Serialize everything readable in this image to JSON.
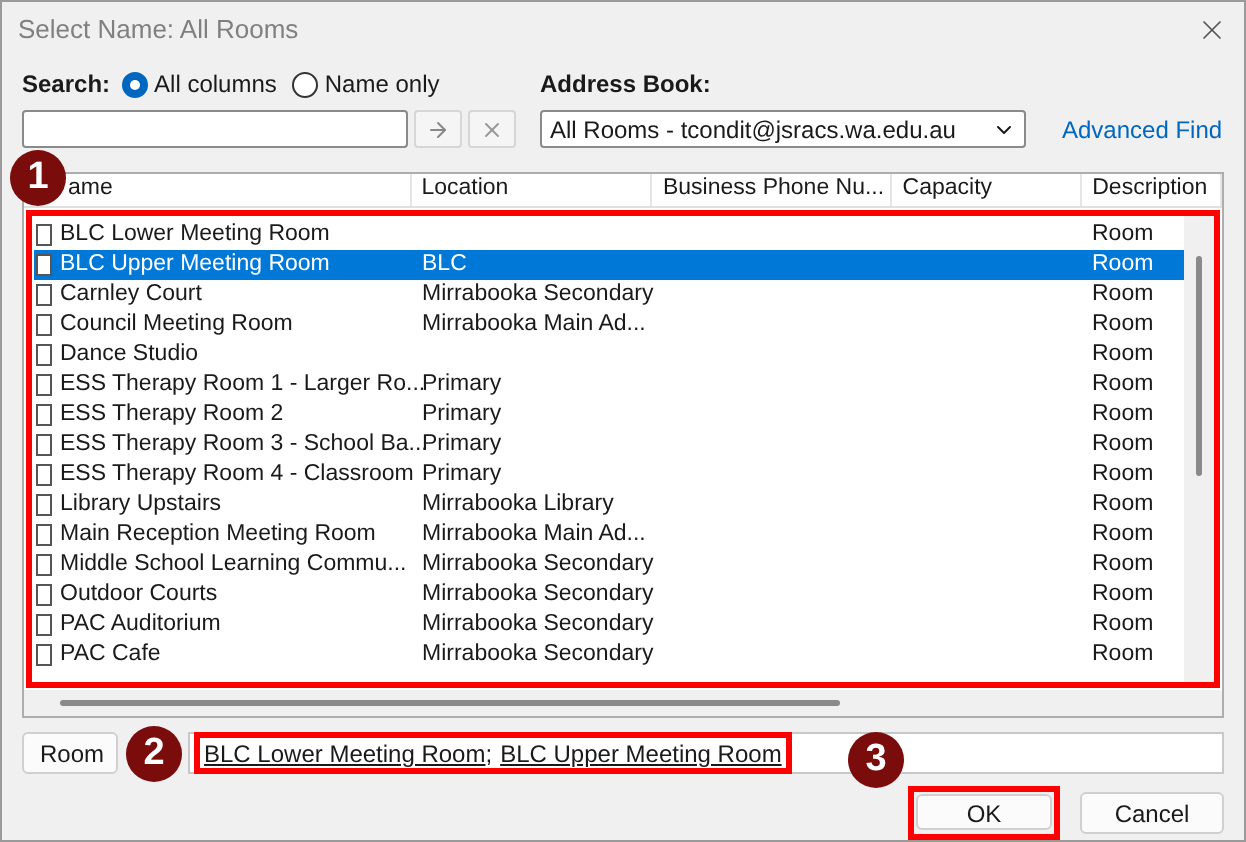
{
  "window": {
    "title": "Select Name: All Rooms"
  },
  "search": {
    "label": "Search:",
    "options": [
      {
        "label": "All columns",
        "selected": true
      },
      {
        "label": "Name only",
        "selected": false
      }
    ]
  },
  "address_book": {
    "label": "Address Book:",
    "value": "All Rooms - tcondit@jsracs.wa.edu.au"
  },
  "advanced_find": "Advanced Find",
  "table": {
    "columns": [
      "ame",
      "Location",
      "Business Phone Nu...",
      "Capacity",
      "Description"
    ],
    "rows": [
      {
        "name": "BLC Lower Meeting Room",
        "location": "",
        "description": "Room",
        "selected": false
      },
      {
        "name": "BLC Upper Meeting Room",
        "location": "BLC",
        "description": "Room",
        "selected": true
      },
      {
        "name": "Carnley Court",
        "location": "Mirrabooka Secondary",
        "description": "Room",
        "selected": false
      },
      {
        "name": "Council Meeting Room",
        "location": "Mirrabooka Main Ad...",
        "description": "Room",
        "selected": false
      },
      {
        "name": "Dance Studio",
        "location": "",
        "description": "Room",
        "selected": false
      },
      {
        "name": "ESS Therapy Room 1 - Larger Ro...",
        "location": "Primary",
        "description": "Room",
        "selected": false
      },
      {
        "name": "ESS Therapy Room 2",
        "location": "Primary",
        "description": "Room",
        "selected": false
      },
      {
        "name": "ESS Therapy Room 3 - School Ba...",
        "location": "Primary",
        "description": "Room",
        "selected": false
      },
      {
        "name": "ESS Therapy Room 4 - Classroom",
        "location": "Primary",
        "description": "Room",
        "selected": false
      },
      {
        "name": "Library Upstairs",
        "location": "Mirrabooka Library",
        "description": "Room",
        "selected": false
      },
      {
        "name": "Main Reception Meeting Room",
        "location": "Mirrabooka Main Ad...",
        "description": "Room",
        "selected": false
      },
      {
        "name": "Middle School Learning Commu...",
        "location": "Mirrabooka Secondary",
        "description": "Room",
        "selected": false
      },
      {
        "name": "Outdoor Courts",
        "location": "Mirrabooka Secondary",
        "description": "Room",
        "selected": false
      },
      {
        "name": "PAC Auditorium",
        "location": "Mirrabooka Secondary",
        "description": "Room",
        "selected": false
      },
      {
        "name": "PAC Cafe",
        "location": "Mirrabooka Secondary",
        "description": "Room",
        "selected": false
      }
    ]
  },
  "recipients": {
    "button": "Room",
    "entries": [
      "BLC Lower Meeting Room",
      "BLC Upper Meeting Room"
    ],
    "separator": ";"
  },
  "buttons": [
    {
      "label": "OK"
    },
    {
      "label": "Cancel"
    }
  ],
  "annotations": [
    {
      "number": "1"
    },
    {
      "number": "2"
    },
    {
      "number": "3"
    }
  ]
}
